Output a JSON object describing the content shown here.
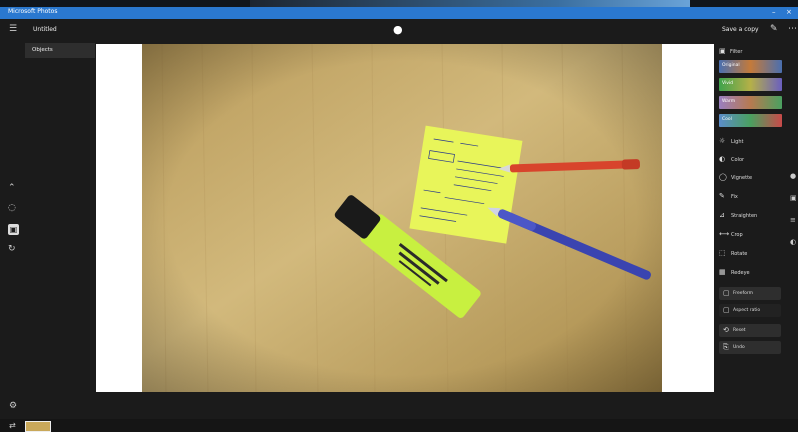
{
  "window": {
    "title": "Microsoft Photos",
    "controls": [
      "–",
      "×"
    ]
  },
  "toolbar": {
    "menu_icon": "menu-icon",
    "file_name": "Untitled",
    "drop_icon": "drop-icon",
    "save_label": "Save a copy",
    "pen_icon": "✎",
    "more_icon": "⋯"
  },
  "left_panel": {
    "selected_item": "Objects",
    "tools": [
      {
        "name": "up-icon",
        "glyph": "⌃"
      },
      {
        "name": "brightness-icon",
        "glyph": "◌"
      },
      {
        "name": "crop-icon",
        "glyph": "▣"
      },
      {
        "name": "rotate-icon",
        "glyph": "↻"
      }
    ],
    "settings_glyph": "⚙"
  },
  "right_panel": {
    "filter_header": "Filter",
    "filters": [
      {
        "label": "Original",
        "color": "#4a6fb0"
      },
      {
        "label": "Vivid",
        "color": "#3fa34d"
      },
      {
        "label": "Warm",
        "color": "#9a7fc0"
      },
      {
        "label": "Cool",
        "color": "#5b8cc9"
      }
    ],
    "adjustments": [
      {
        "icon": "☼",
        "label": "Light"
      },
      {
        "icon": "◐",
        "label": "Color"
      },
      {
        "icon": "◯",
        "label": "Vignette"
      },
      {
        "icon": "✎",
        "label": "Fix"
      },
      {
        "icon": "⊿",
        "label": "Straighten"
      },
      {
        "icon": "⟷",
        "label": "Crop"
      },
      {
        "icon": "⬚",
        "label": "Rotate"
      },
      {
        "icon": "▦",
        "label": "Redeye"
      }
    ],
    "boxes": [
      {
        "icon": "▢",
        "label": "Freeform"
      },
      {
        "icon": "▢",
        "label": "Aspect ratio"
      }
    ],
    "actions": [
      {
        "icon": "⟲",
        "label": "Reset"
      },
      {
        "icon": "⎘",
        "label": "Undo"
      }
    ],
    "edge_icons": [
      "●",
      "▣",
      "≡",
      "◐"
    ]
  },
  "bottom": {
    "icon": "⇄"
  },
  "colors": {
    "title_bar": "#2a78d0",
    "panel_bg": "#1b1b1b",
    "canvas_bg": "#ffffff"
  }
}
